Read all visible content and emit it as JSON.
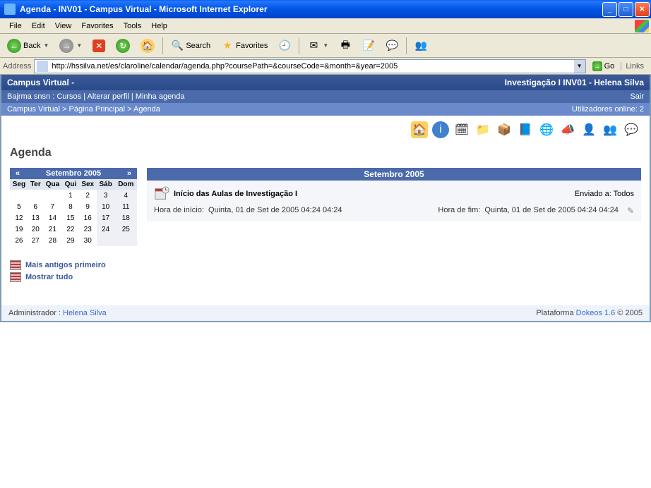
{
  "window": {
    "title": "Agenda - INV01 - Campus Virtual - Microsoft Internet Explorer"
  },
  "menubar": [
    "File",
    "Edit",
    "View",
    "Favorites",
    "Tools",
    "Help"
  ],
  "toolbar": {
    "back": "Back",
    "search": "Search",
    "favorites": "Favorites"
  },
  "address": {
    "label": "Address",
    "url": "http://hssilva.net/es/claroline/calendar/agenda.php?coursePath=&courseCode=&month=&year=2005",
    "go": "Go",
    "links": "Links"
  },
  "campus": {
    "left": "Campus Virtual -",
    "right": "Investigação I INV01 - Helena Silva"
  },
  "nav": {
    "links": [
      "Bajrma snsn",
      "Cursos",
      "Alterar perfil",
      "Minha agenda"
    ],
    "right": "Sair"
  },
  "breadcrumb": {
    "items": [
      "Campus Virtual",
      "Página Principal",
      "Agenda"
    ],
    "users": "Utilizadores online: 2"
  },
  "page_title": "Agenda",
  "calendar": {
    "month": "Setembro 2005",
    "prev": "«",
    "next": "»",
    "days": [
      "Seg",
      "Ter",
      "Qua",
      "Qui",
      "Sex",
      "Sáb",
      "Dom"
    ],
    "weeks": [
      [
        "",
        "",
        "",
        "1",
        "2",
        "3",
        "4"
      ],
      [
        "5",
        "6",
        "7",
        "8",
        "9",
        "10",
        "11"
      ],
      [
        "12",
        "13",
        "14",
        "15",
        "16",
        "17",
        "18"
      ],
      [
        "19",
        "20",
        "21",
        "22",
        "23",
        "24",
        "25"
      ],
      [
        "26",
        "27",
        "28",
        "29",
        "30",
        "",
        ""
      ]
    ]
  },
  "cal_links": {
    "oldest": "Mais antigos primeiro",
    "showall": "Mostrar tudo"
  },
  "events": {
    "header": "Setembro 2005",
    "item": {
      "title": "Início das Aulas de Investigação I",
      "sent": "Enviado a: Todos",
      "start_label": "Hora de início:",
      "start_val": "Quinta, 01 de Set de 2005   04:24 04:24",
      "end_label": "Hora de fim:",
      "end_val": "Quinta, 01 de Set de 2005   04:24 04:24"
    }
  },
  "footer": {
    "admin_label": "Administrador :",
    "admin_name": "Helena Silva",
    "platform_label": "Plataforma",
    "platform_name": "Dokeos 1.6",
    "copyright": "© 2005"
  },
  "app_icons": [
    "home-icon",
    "info-icon",
    "agenda-icon",
    "docs-icon",
    "box-icon",
    "scorm-icon",
    "links-icon",
    "announce-icon",
    "users-icon",
    "groups-icon",
    "chat-icon"
  ]
}
